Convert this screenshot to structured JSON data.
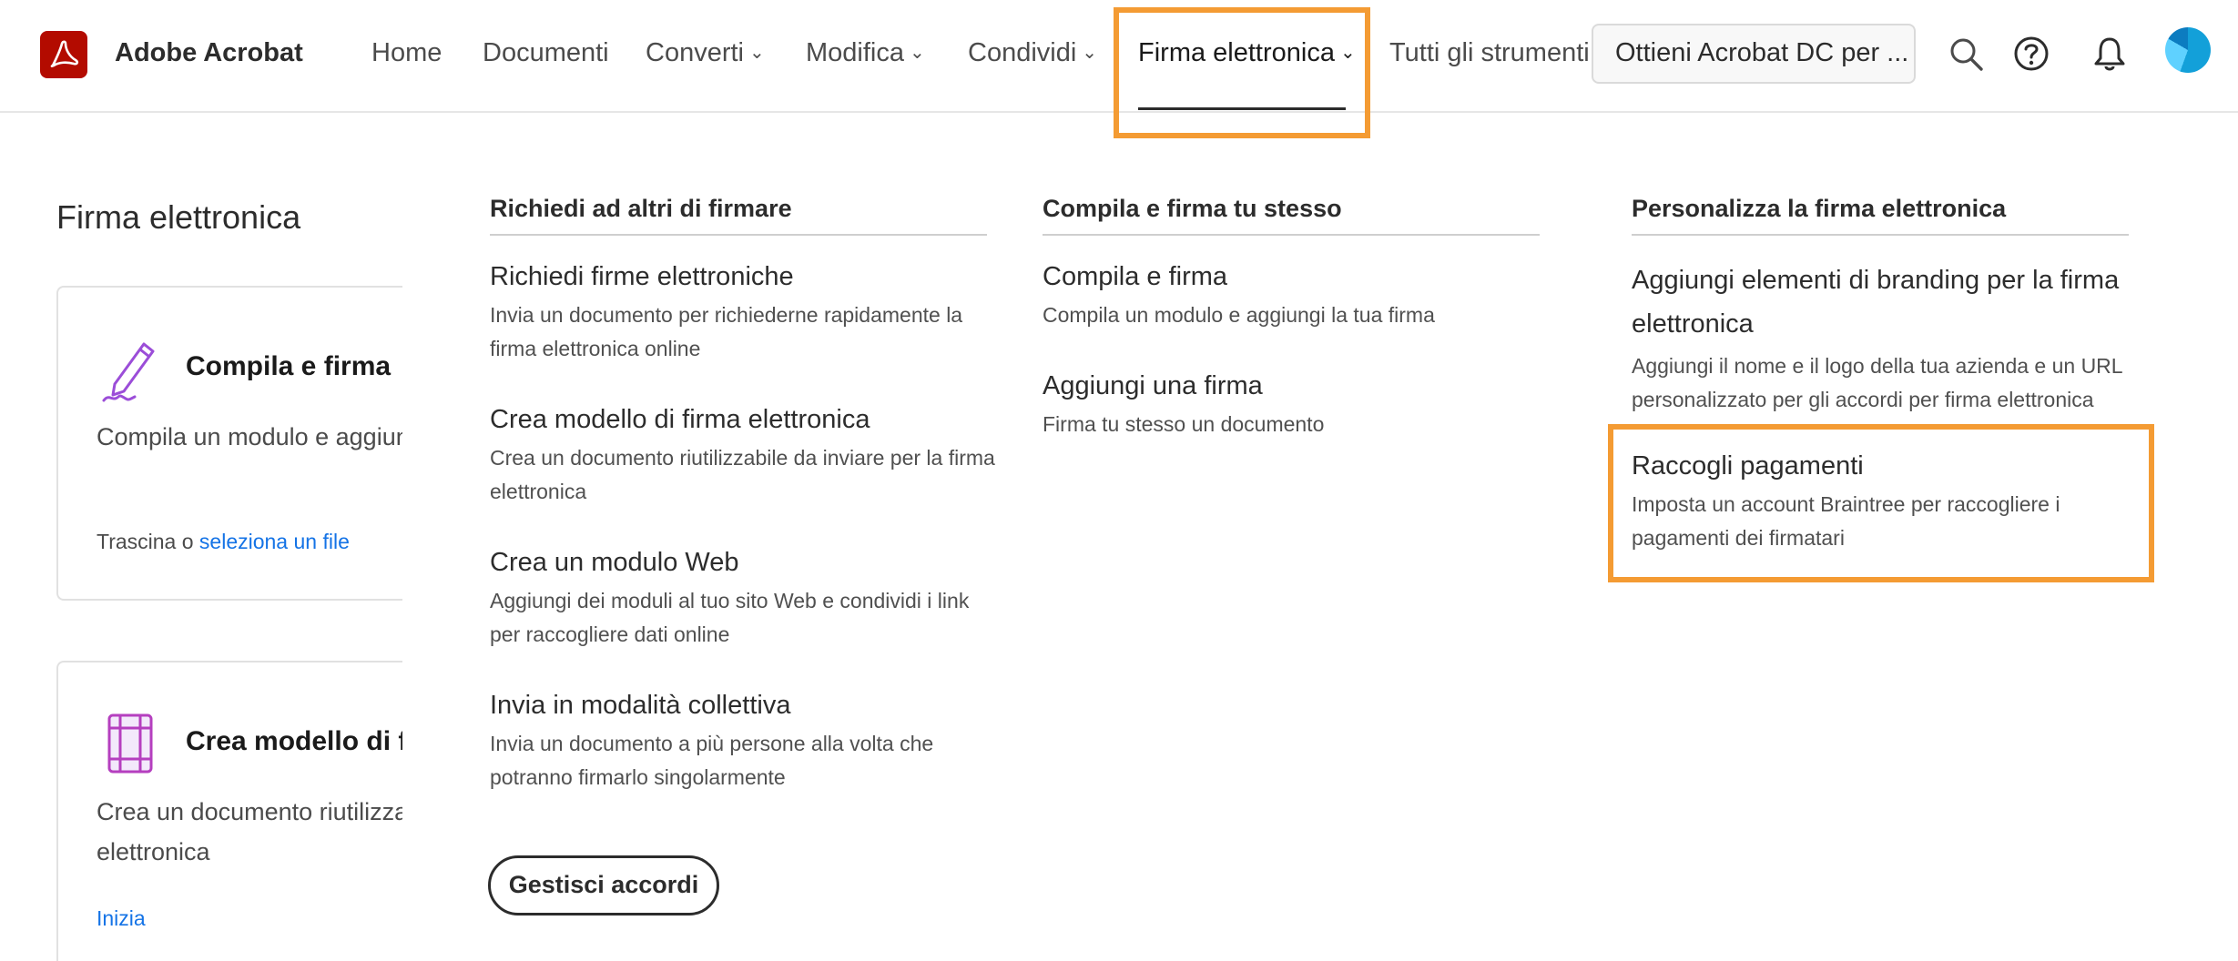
{
  "brand": {
    "name": "Adobe Acrobat",
    "logo_icon": "acrobat-logo-icon",
    "logo_color": "#b30b00"
  },
  "nav": {
    "items": [
      {
        "label": "Home",
        "dropdown": false
      },
      {
        "label": "Documenti",
        "dropdown": false
      },
      {
        "label": "Converti",
        "dropdown": true
      },
      {
        "label": "Modifica",
        "dropdown": true
      },
      {
        "label": "Condividi",
        "dropdown": true
      },
      {
        "label": "Firma elettronica",
        "dropdown": true,
        "active": true
      },
      {
        "label": "Tutti gli strumenti",
        "dropdown": false
      }
    ],
    "cta_label": "Ottieni Acrobat DC per ...",
    "icons": [
      "search-icon",
      "help-icon",
      "bell-icon",
      "avatar"
    ]
  },
  "left_panel": {
    "title": "Firma elettronica",
    "cards": [
      {
        "title": "Compila e firma",
        "desc": "Compila un modulo e aggiungi la tua firma",
        "foot_text": "Trascina o ",
        "foot_link": "seleziona un file",
        "icon": "pen-sign-icon"
      },
      {
        "title": "Crea modello di firma elettronica",
        "desc_line1": "Crea un documento riutilizzabile da inviare per la firma",
        "desc_line2": "elettronica",
        "foot_link": "Inizia",
        "icon": "template-icon"
      }
    ]
  },
  "menu": {
    "col1": {
      "heading": "Richiedi ad altri di firmare",
      "items": [
        {
          "title": "Richiedi firme elettroniche",
          "desc": "Invia un documento per richiederne rapidamente la firma elettronica online"
        },
        {
          "title": "Crea modello di firma elettronica",
          "desc": "Crea un documento riutilizzabile da inviare per la firma elettronica"
        },
        {
          "title": "Crea un modulo Web",
          "desc": "Aggiungi dei moduli al tuo sito Web e condividi i link per raccogliere dati online"
        },
        {
          "title": "Invia in modalità collettiva",
          "desc": "Invia un documento a più persone alla volta che potranno firmarlo singolarmente"
        }
      ],
      "button_label": "Gestisci accordi"
    },
    "col2": {
      "heading": "Compila e firma tu stesso",
      "items": [
        {
          "title": "Compila e firma",
          "desc": "Compila un modulo e aggiungi la tua firma"
        },
        {
          "title": "Aggiungi una firma",
          "desc": "Firma tu stesso un documento"
        }
      ]
    },
    "col3": {
      "heading": "Personalizza la firma elettronica",
      "items": [
        {
          "title": "Aggiungi elementi di branding per la firma elettronica",
          "desc": "Aggiungi il nome e il logo della tua azienda e un URL personalizzato per gli accordi per firma elettronica"
        },
        {
          "title": "Raccogli pagamenti",
          "desc": "Imposta un account Braintree per raccogliere i pagamenti dei firmatari"
        }
      ]
    }
  },
  "colors": {
    "highlight": "#f49b33",
    "link": "#1473e6",
    "text": "#2c2c2c"
  }
}
